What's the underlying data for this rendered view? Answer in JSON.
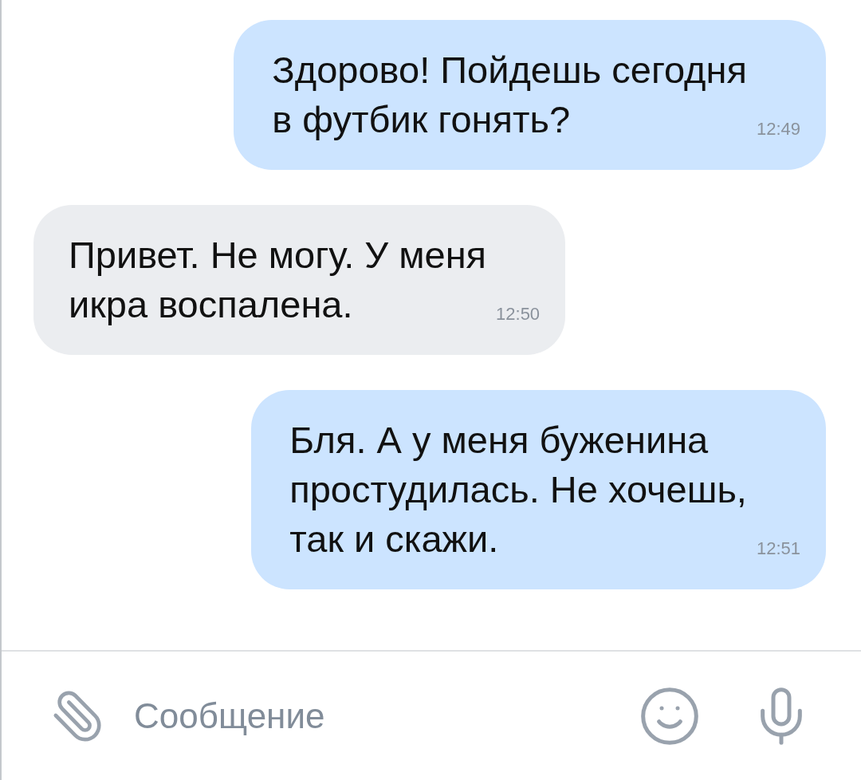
{
  "messages": [
    {
      "kind": "outgoing",
      "text": "Здорово! Пойдешь сегодня\nв футбик гонять?",
      "time": "12:49"
    },
    {
      "kind": "incoming",
      "text": "Привет. Не могу. У меня\nикра воспалена.",
      "time": "12:50"
    },
    {
      "kind": "outgoing",
      "text": "Бля. А у меня буженина\nпростудилась. Не хочешь,\nтак и скажи.",
      "time": "12:51"
    }
  ],
  "composer": {
    "placeholder": "Сообщение"
  }
}
